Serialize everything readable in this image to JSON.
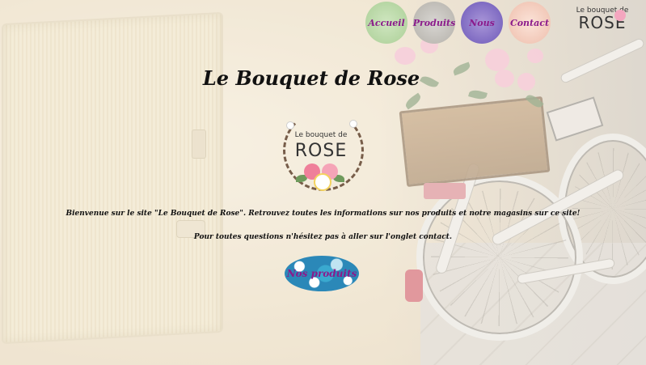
{
  "nav": {
    "items": [
      {
        "label": "Accueil"
      },
      {
        "label": "Produits"
      },
      {
        "label": "Nous"
      },
      {
        "label": "Contact"
      }
    ]
  },
  "logo_small": {
    "line1": "Le bouquet de",
    "line2": "ROSE"
  },
  "page": {
    "title": "Le Bouquet de Rose"
  },
  "logo": {
    "line1": "Le bouquet de",
    "line2": "ROSE"
  },
  "content": {
    "welcome": "Bienvenue sur le site \"Le Bouquet de Rose\". Retrouvez toutes les informations sur nos produits et notre magasins sur ce site!",
    "contact_line": "Pour toutes questions n'hésitez pas à aller sur l'onglet contact."
  },
  "cta": {
    "label": "Nos produits"
  },
  "colors": {
    "accent_text": "#8b1a8b",
    "title": "#111111"
  }
}
